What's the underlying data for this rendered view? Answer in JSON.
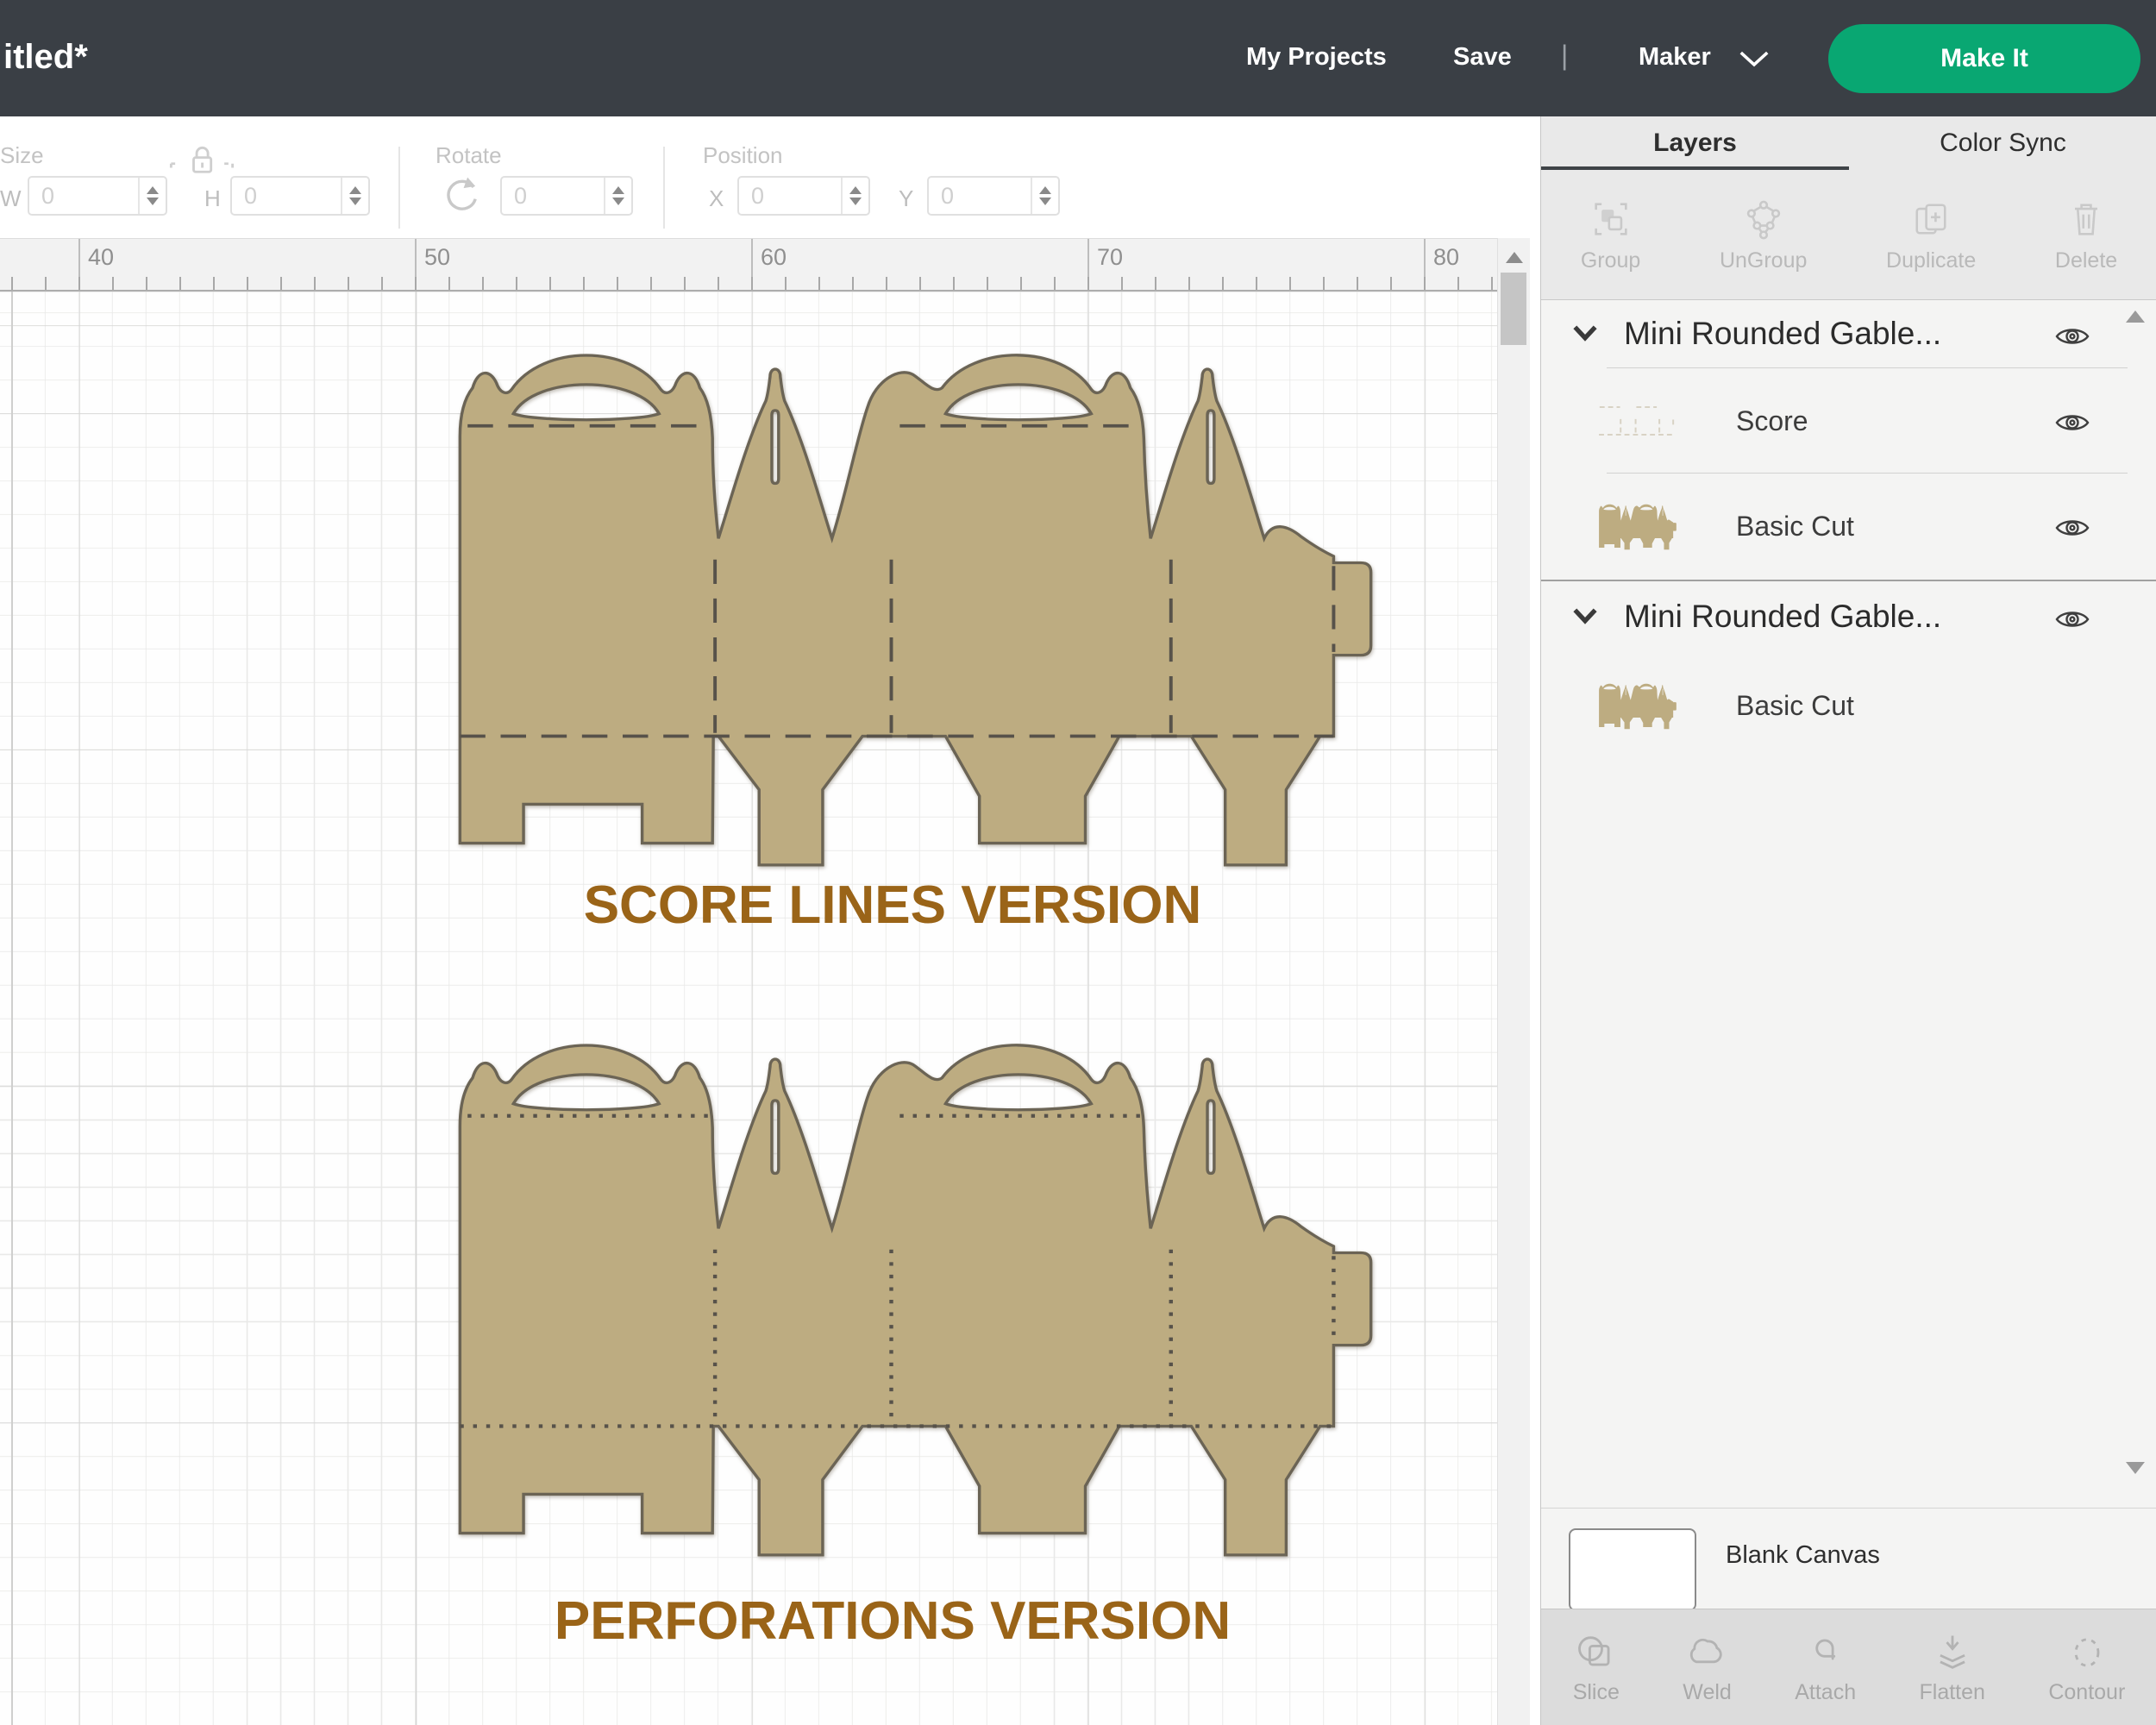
{
  "header": {
    "title": "itled*",
    "my_projects": "My Projects",
    "save": "Save",
    "divider": "|",
    "machine": "Maker",
    "make_it": "Make It",
    "background_color": "#3a3f45",
    "accent_color": "#09a772"
  },
  "toolbar": {
    "size": {
      "label": "Size",
      "w_label": "W",
      "w_value": "0",
      "h_label": "H",
      "h_value": "0"
    },
    "rotate": {
      "label": "Rotate",
      "value": "0"
    },
    "position": {
      "label": "Position",
      "x_label": "X",
      "x_value": "0",
      "y_label": "Y",
      "y_value": "0"
    }
  },
  "ruler": {
    "ticks": [
      "40",
      "50",
      "60",
      "70",
      "80"
    ]
  },
  "canvas": {
    "score_caption": "SCORE LINES VERSION",
    "perforations_caption": "PERFORATIONS VERSION",
    "caption_color": "#9a6418",
    "material_color": "#bdac81",
    "outline_color": "#6b6455"
  },
  "layers_panel": {
    "tabs": [
      {
        "label": "Layers",
        "active": true
      },
      {
        "label": "Color Sync",
        "active": false
      }
    ],
    "actions": [
      {
        "label": "Group"
      },
      {
        "label": "UnGroup"
      },
      {
        "label": "Duplicate"
      },
      {
        "label": "Delete"
      }
    ],
    "groups": [
      {
        "title": "Mini Rounded Gable...",
        "children": [
          {
            "label": "Score",
            "type": "score"
          },
          {
            "label": "Basic Cut",
            "type": "cut"
          }
        ]
      },
      {
        "title": "Mini Rounded Gable...",
        "children": [
          {
            "label": "Basic Cut",
            "type": "cut"
          }
        ]
      }
    ],
    "blank_canvas_label": "Blank Canvas",
    "bottom_actions": [
      {
        "label": "Slice"
      },
      {
        "label": "Weld"
      },
      {
        "label": "Attach"
      },
      {
        "label": "Flatten"
      },
      {
        "label": "Contour"
      }
    ]
  },
  "icons": {
    "visibility": "eye-icon",
    "collapse": "chevron-down-icon",
    "lock": "lock-icon",
    "rotate": "rotate-icon"
  }
}
